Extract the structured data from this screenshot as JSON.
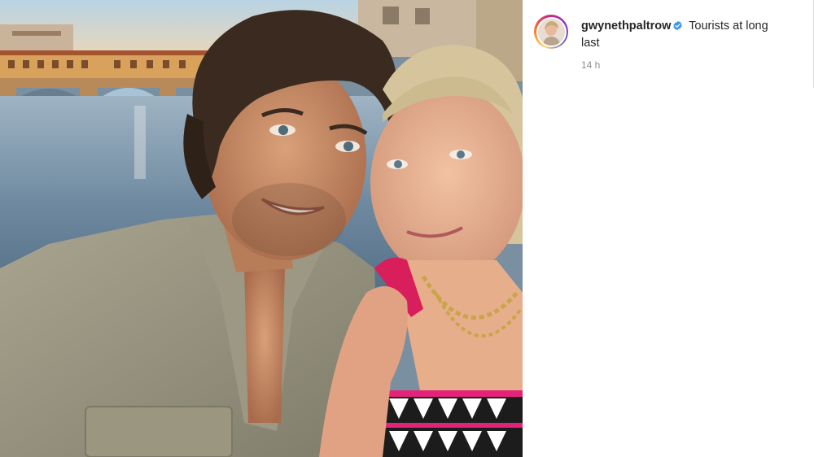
{
  "post": {
    "username": "gwynethpaltrow",
    "caption": "Tourists at long last",
    "timestamp": "14 h",
    "verified": true
  },
  "icons": {
    "verified": "verified-badge-icon",
    "avatar": "profile-avatar"
  },
  "colors": {
    "verified_blue": "#3897f0",
    "timestamp_gray": "#8e8e8e",
    "text": "#262626"
  }
}
